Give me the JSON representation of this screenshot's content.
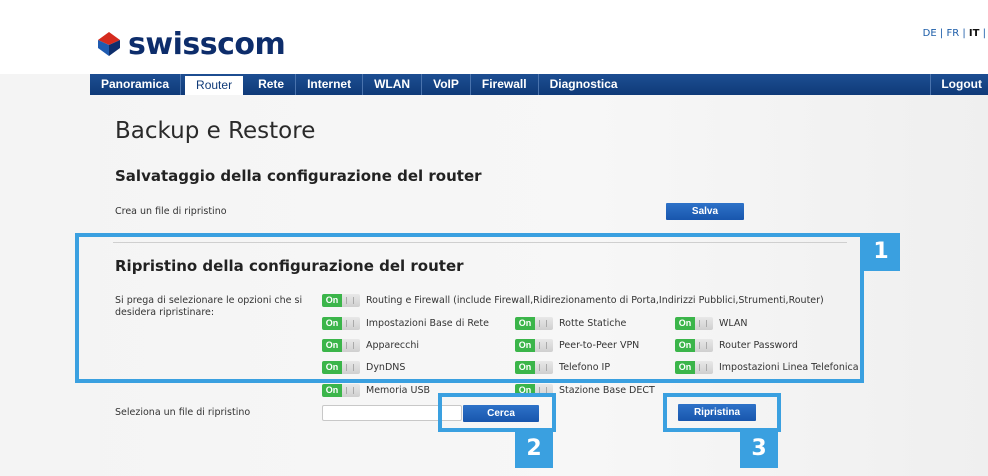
{
  "brand": {
    "name": "swisscom",
    "logo_icon": "swisscom-logo-icon"
  },
  "languages": {
    "de": "DE",
    "fr": "FR",
    "it": "IT",
    "sep": "|"
  },
  "nav": {
    "items": [
      "Panoramica",
      "Router",
      "Rete",
      "Internet",
      "WLAN",
      "VoIP",
      "Firewall",
      "Diagnostica"
    ],
    "active": "Router",
    "logout": "Logout"
  },
  "page_title": "Backup e Restore",
  "backup": {
    "heading": "Salvataggio della configurazione del router",
    "create_label": "Crea un file di ripristino",
    "save_button": "Salva"
  },
  "restore": {
    "heading": "Ripristino della configurazione del router",
    "instructions": "Si prega di selezionare le opzioni che si desidera ripristinare:",
    "toggle_on_text": "On",
    "options": [
      "Routing e Firewall (include Firewall,Ridirezionamento di Porta,Indirizzi Pubblici,Strumenti,Router)",
      "Impostazioni Base di Rete",
      "Rotte Statiche",
      "WLAN",
      "Apparecchi",
      "Peer-to-Peer VPN",
      "Router Password",
      "DynDNS",
      "Telefono IP",
      "Impostazioni Linea Telefonica",
      "Memoria USB",
      "Stazione Base DECT"
    ],
    "file_label": "Seleziona un file di ripristino",
    "file_value": "",
    "browse_button": "Cerca",
    "restore_button": "Ripristina"
  },
  "callouts": [
    "1",
    "2",
    "3"
  ],
  "colors": {
    "nav_bg": "#0f3a78",
    "button": "#1e5fb5",
    "toggle_on": "#3bb54a",
    "callout": "#3aa0e0",
    "logo_red": "#d52b1e"
  }
}
